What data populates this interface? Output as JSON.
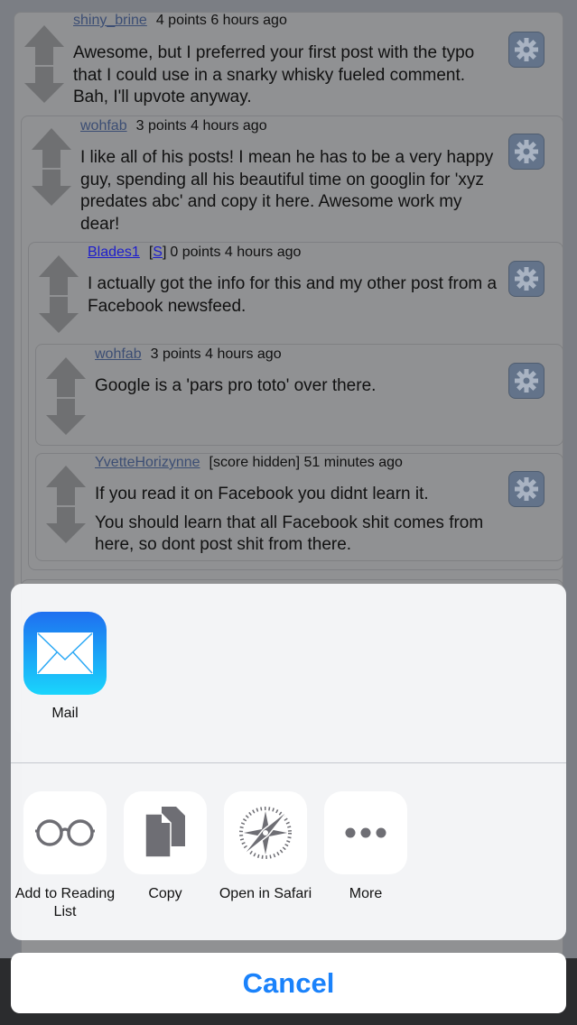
{
  "comments": [
    {
      "user": "shiny_brine",
      "tag": "",
      "score": "4 points",
      "time": "6 hours ago",
      "body": [
        "Awesome, but I preferred your first post with the typo that I could use in a snarky whisky fueled comment. Bah, I'll upvote anyway."
      ]
    },
    {
      "user": "wohfab",
      "tag": "",
      "score": "3 points",
      "time": "4 hours ago",
      "body": [
        "I like all of his posts! I mean he has to be a very happy guy, spending all his beautiful time on googlin for 'xyz predates abc' and copy it here. Awesome work my dear!"
      ]
    },
    {
      "user": "Blades1",
      "tag": "S",
      "score": "0 points",
      "time": "4 hours ago",
      "body": [
        "I actually got the info for this and my other post from a Facebook newsfeed."
      ]
    },
    {
      "user": "wohfab",
      "tag": "",
      "score": "3 points",
      "time": "4 hours ago",
      "body": [
        "Google is a 'pars pro toto' over there."
      ]
    },
    {
      "user": "YvetteHorizynne",
      "tag": "",
      "score": "[score hidden]",
      "time": "51 minutes ago",
      "body": [
        "If you read it on Facebook you didnt learn it.",
        "You should learn that all Facebook shit comes from here, so dont post shit from there."
      ]
    }
  ],
  "share_sheet": {
    "apps": [
      {
        "label": "Mail",
        "icon": "mail-icon"
      }
    ],
    "actions": [
      {
        "label": "Add to Reading List",
        "icon": "glasses-icon"
      },
      {
        "label": "Copy",
        "icon": "copy-icon"
      },
      {
        "label": "Open in Safari",
        "icon": "compass-icon"
      },
      {
        "label": "More",
        "icon": "more-icon"
      }
    ],
    "cancel_label": "Cancel"
  },
  "colors": {
    "accent": "#1a82fb"
  }
}
